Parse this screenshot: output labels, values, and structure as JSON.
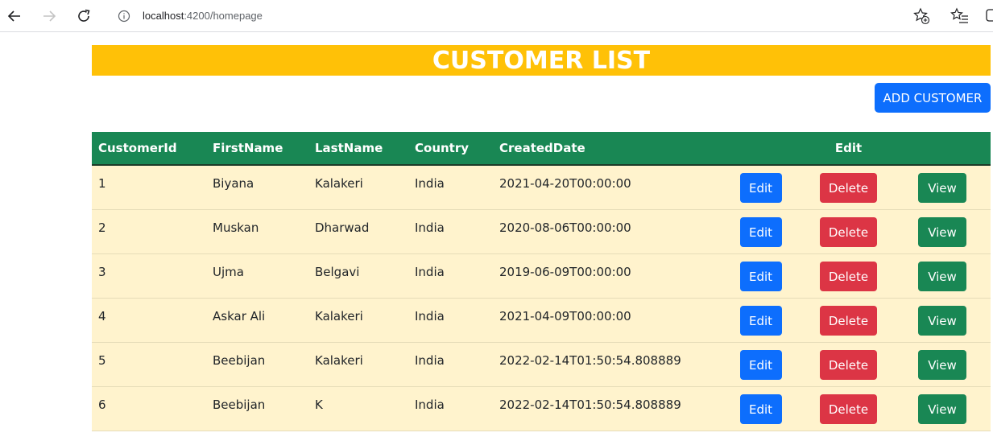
{
  "browser": {
    "url_host": "localhost",
    "url_rest": ":4200/homepage",
    "icons": [
      "back-arrow-icon",
      "forward-arrow-icon",
      "reload-icon",
      "info-icon",
      "favorite-star-add-icon",
      "favorites-list-icon",
      "collections-icon"
    ]
  },
  "page": {
    "title": "CUSTOMER LIST",
    "add_button_label": "ADD CUSTOMER"
  },
  "colors": {
    "title_bg": "#ffc107",
    "header_bg": "#198754",
    "row_bg": "#fff3cd",
    "edit": "#0d6efd",
    "delete": "#dc3545",
    "view": "#198754"
  },
  "table": {
    "headers": [
      "CustomerId",
      "FirstName",
      "LastName",
      "Country",
      "CreatedDate",
      "",
      "Edit",
      ""
    ],
    "button_labels": {
      "edit": "Edit",
      "delete": "Delete",
      "view": "View"
    },
    "rows": [
      {
        "id": "1",
        "first": "Biyana",
        "last": "Kalakeri",
        "country": "India",
        "created": "2021-04-20T00:00:00"
      },
      {
        "id": "2",
        "first": "Muskan",
        "last": "Dharwad",
        "country": "India",
        "created": "2020-08-06T00:00:00"
      },
      {
        "id": "3",
        "first": "Ujma",
        "last": "Belgavi",
        "country": "India",
        "created": "2019-06-09T00:00:00"
      },
      {
        "id": "4",
        "first": "Askar Ali",
        "last": "Kalakeri",
        "country": "India",
        "created": "2021-04-09T00:00:00"
      },
      {
        "id": "5",
        "first": "Beebijan",
        "last": "Kalakeri",
        "country": "India",
        "created": "2022-02-14T01:50:54.808889"
      },
      {
        "id": "6",
        "first": "Beebijan",
        "last": "K",
        "country": "India",
        "created": "2022-02-14T01:50:54.808889"
      }
    ]
  }
}
